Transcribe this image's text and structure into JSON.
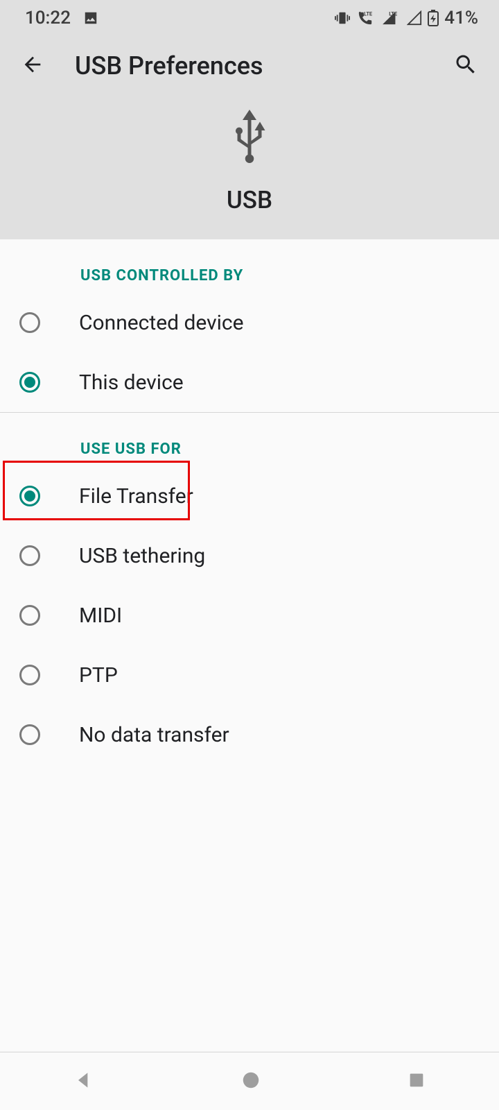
{
  "statusbar": {
    "time": "10:22",
    "battery_pct": "41%"
  },
  "header": {
    "title": "USB Preferences"
  },
  "hero": {
    "label": "USB"
  },
  "sections": {
    "controlled_by": {
      "title": "USB CONTROLLED BY",
      "options": [
        {
          "label": "Connected device",
          "checked": false
        },
        {
          "label": "This device",
          "checked": true
        }
      ]
    },
    "use_usb_for": {
      "title": "USE USB FOR",
      "options": [
        {
          "label": "File Transfer",
          "checked": true,
          "highlighted": true
        },
        {
          "label": "USB tethering",
          "checked": false
        },
        {
          "label": "MIDI",
          "checked": false
        },
        {
          "label": "PTP",
          "checked": false
        },
        {
          "label": "No data transfer",
          "checked": false
        }
      ]
    }
  },
  "colors": {
    "accent": "#00897b",
    "highlight_border": "#e60000"
  }
}
